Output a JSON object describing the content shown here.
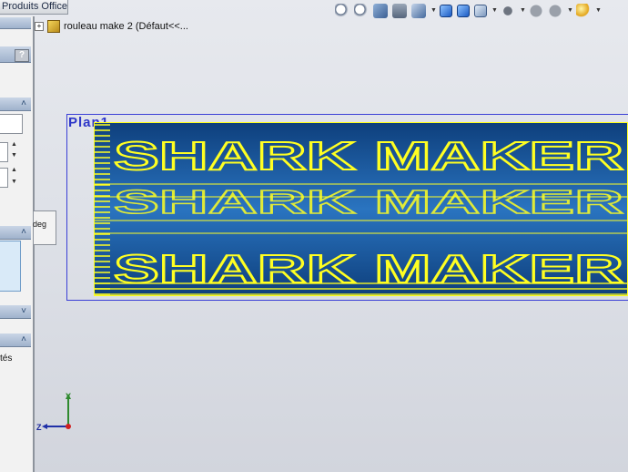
{
  "window": {
    "office_tab": "Produits Office"
  },
  "tree": {
    "item_label": "rouleau make 2  (Défaut<<..."
  },
  "left_panel": {
    "help_label": "?",
    "deg_label": "deg",
    "properties_label": "tés"
  },
  "canvas": {
    "plane_label": "Plan1",
    "roll_text_rows": [
      "SHARK MAKER",
      "SHARK MAKER",
      "SHARK MAKER"
    ],
    "colors": {
      "roll_blue": "#1f5fa6",
      "text_yellow": "#ffff22",
      "plane_border": "#3a3fd6"
    }
  },
  "triad": {
    "y_label": "Y",
    "z_label": "Z"
  },
  "toolbar": {
    "icons": [
      "zoom-fit-icon",
      "zoom-area-icon",
      "previous-view-icon",
      "section-view-icon",
      "view-orientation-icon",
      "display-style-icon",
      "shaded-edges-icon",
      "hide-show-icon",
      "edit-appearance-icon",
      "apply-scene-icon",
      "view-settings-icon",
      "realview-icon",
      "sphere-icon"
    ]
  }
}
